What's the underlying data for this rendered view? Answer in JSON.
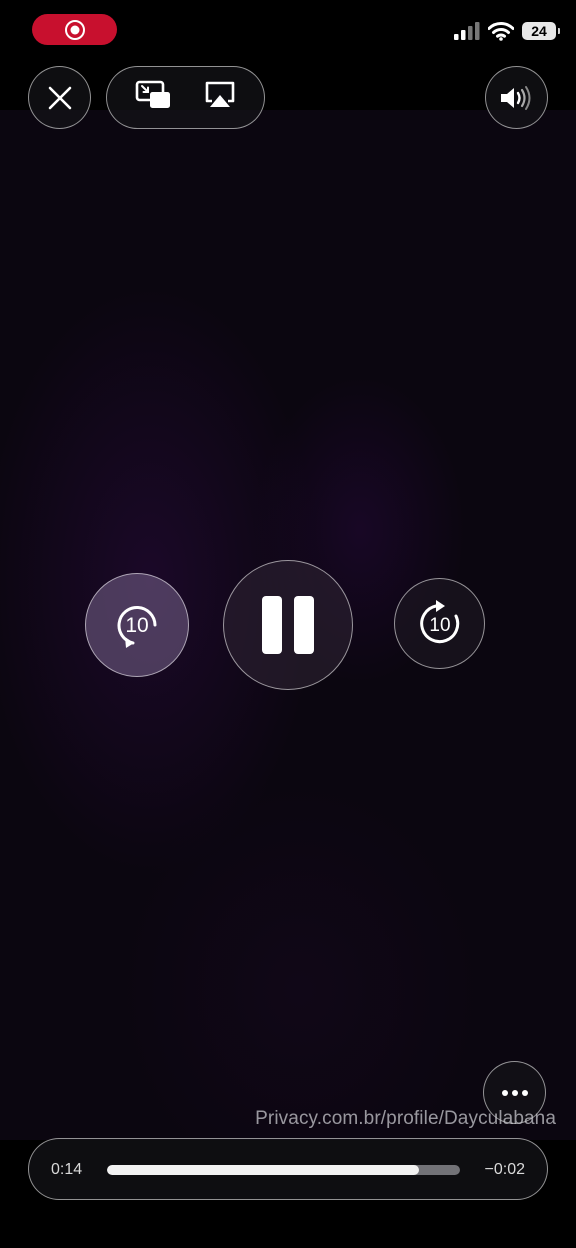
{
  "status_bar": {
    "recording_icon": "record-icon",
    "signal_icon": "cellular-signal-icon",
    "wifi_icon": "wifi-icon",
    "battery_level": "24"
  },
  "top_controls": {
    "close_icon": "close-icon",
    "pip_icon": "picture-in-picture-icon",
    "airplay_icon": "airplay-icon",
    "volume_icon": "speaker-volume-icon"
  },
  "playback": {
    "skip_back_label": "10",
    "skip_forward_label": "10",
    "pause_icon": "pause-icon"
  },
  "more_icon": "ellipsis-icon",
  "watermark": "Privacy.com.br/profile/Dayculabana",
  "progress": {
    "elapsed": "0:14",
    "remaining": "−0:02",
    "played_fraction": 0.885,
    "buffered_fraction": 1.0
  },
  "colors": {
    "recording_pill": "#c8102e",
    "progress_fill": "#f2f2f2"
  }
}
